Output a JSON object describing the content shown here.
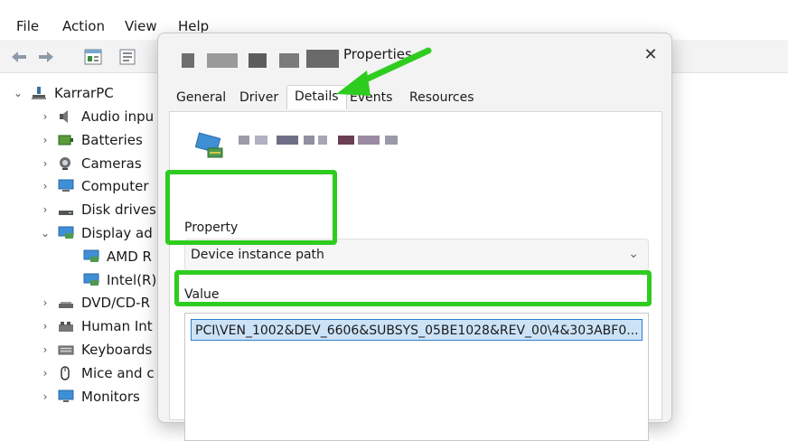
{
  "menu": [
    "File",
    "Action",
    "View",
    "Help"
  ],
  "tree": {
    "root": "KarrarPC",
    "items": [
      {
        "label": "Audio inpu",
        "chev": "›",
        "icon": "speaker-icon"
      },
      {
        "label": "Batteries",
        "chev": "›",
        "icon": "battery-icon"
      },
      {
        "label": "Cameras",
        "chev": "›",
        "icon": "camera-icon"
      },
      {
        "label": "Computer",
        "chev": "›",
        "icon": "computer-icon"
      },
      {
        "label": "Disk drives",
        "chev": "›",
        "icon": "disk-drive-icon"
      },
      {
        "label": "Display ad",
        "chev": "⌄",
        "icon": "display-adapter-icon"
      },
      {
        "label": "AMD R",
        "chev": "",
        "icon": "display-adapter-icon"
      },
      {
        "label": "Intel(R)",
        "chev": "",
        "icon": "display-adapter-icon"
      },
      {
        "label": "DVD/CD-R",
        "chev": "›",
        "icon": "dvd-drive-icon"
      },
      {
        "label": "Human Int",
        "chev": "›",
        "icon": "hid-icon"
      },
      {
        "label": "Keyboards",
        "chev": "›",
        "icon": "keyboard-icon"
      },
      {
        "label": "Mice and c",
        "chev": "›",
        "icon": "mouse-icon"
      },
      {
        "label": "Monitors",
        "chev": "›",
        "icon": "monitor-icon"
      }
    ]
  },
  "dialog": {
    "title": "Properties",
    "close": "✕",
    "tabs": [
      "General",
      "Driver",
      "Details",
      "Events",
      "Resources"
    ],
    "active_tab": "Details",
    "property_label": "Property",
    "property_value": "Device instance path",
    "value_label": "Value",
    "value_item": "PCI\\VEN_1002&DEV_6606&SUBSYS_05BE1028&REV_00\\4&303ABF0..."
  },
  "colors": {
    "highlight": "#2ecc1f",
    "selection_bg": "#cce3f7",
    "selection_border": "#2f7fd0"
  }
}
